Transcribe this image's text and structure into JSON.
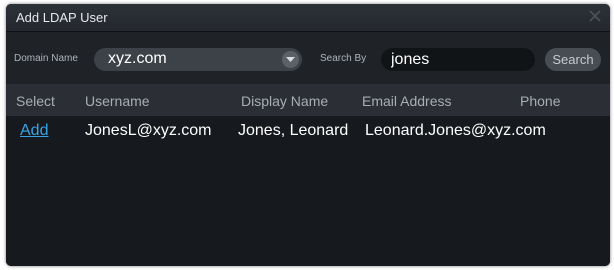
{
  "dialog": {
    "title": "Add LDAP User"
  },
  "toolbar": {
    "domain_label": "Domain Name",
    "domain_value": "xyz.com",
    "search_by_label": "Search By",
    "search_value": "jones",
    "search_button": "Search"
  },
  "table": {
    "columns": [
      "Select",
      "Username",
      "Display Name",
      "Email Address",
      "Phone"
    ],
    "rows": [
      {
        "select": "Add",
        "username": "JonesL@xyz.com",
        "display_name": "Jones, Leonard",
        "email": "Leonard.Jones@xyz.com",
        "phone": ""
      }
    ]
  },
  "colors": {
    "link": "#39a3e6",
    "dialog_bg": "#1a1d22",
    "header_bg": "#2b2f35"
  },
  "icons": {
    "close": "close-icon",
    "dropdown": "chevron-down-icon"
  }
}
